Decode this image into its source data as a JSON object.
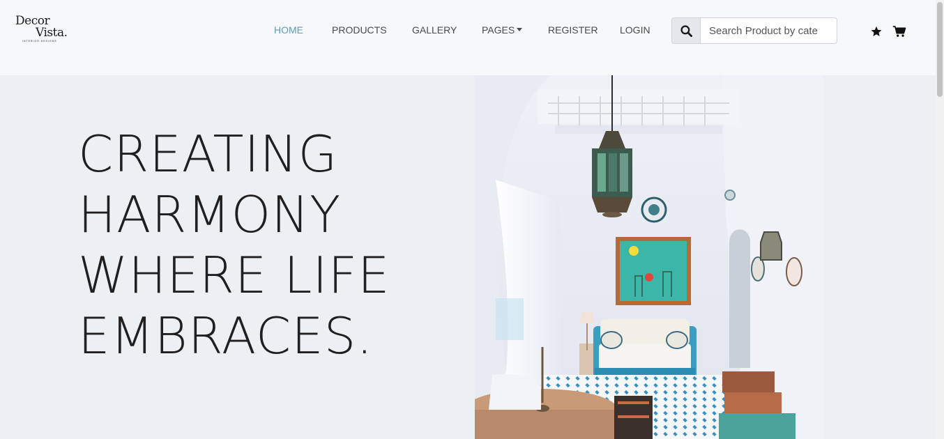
{
  "brand": {
    "line1": "Decor",
    "line2": "Vista.",
    "tagline": "INTERIOR DESIGNS"
  },
  "nav": {
    "items": [
      {
        "label": "HOME",
        "active": true
      },
      {
        "label": "PRODUCTS",
        "active": false
      },
      {
        "label": "GALLERY",
        "active": false
      },
      {
        "label": "PAGES",
        "active": false,
        "dropdown": true
      },
      {
        "label": "REGISTER",
        "active": false
      },
      {
        "label": "LOGIN",
        "active": false
      }
    ]
  },
  "search": {
    "icon": "search-icon",
    "placeholder": "Search Product by cate"
  },
  "header_icons": {
    "favorites": "star-icon",
    "cart": "cart-icon"
  },
  "hero": {
    "title_lines": [
      "CREATING",
      "HARMONY",
      "WHERE LIFE",
      "EMBRACES."
    ],
    "image": "living-room-photo"
  },
  "colors": {
    "accent": "#5a9cb8",
    "nav_text": "#4a4a4a",
    "hero_bg": "#edf0f3",
    "header_bg": "#f6f8fa"
  }
}
